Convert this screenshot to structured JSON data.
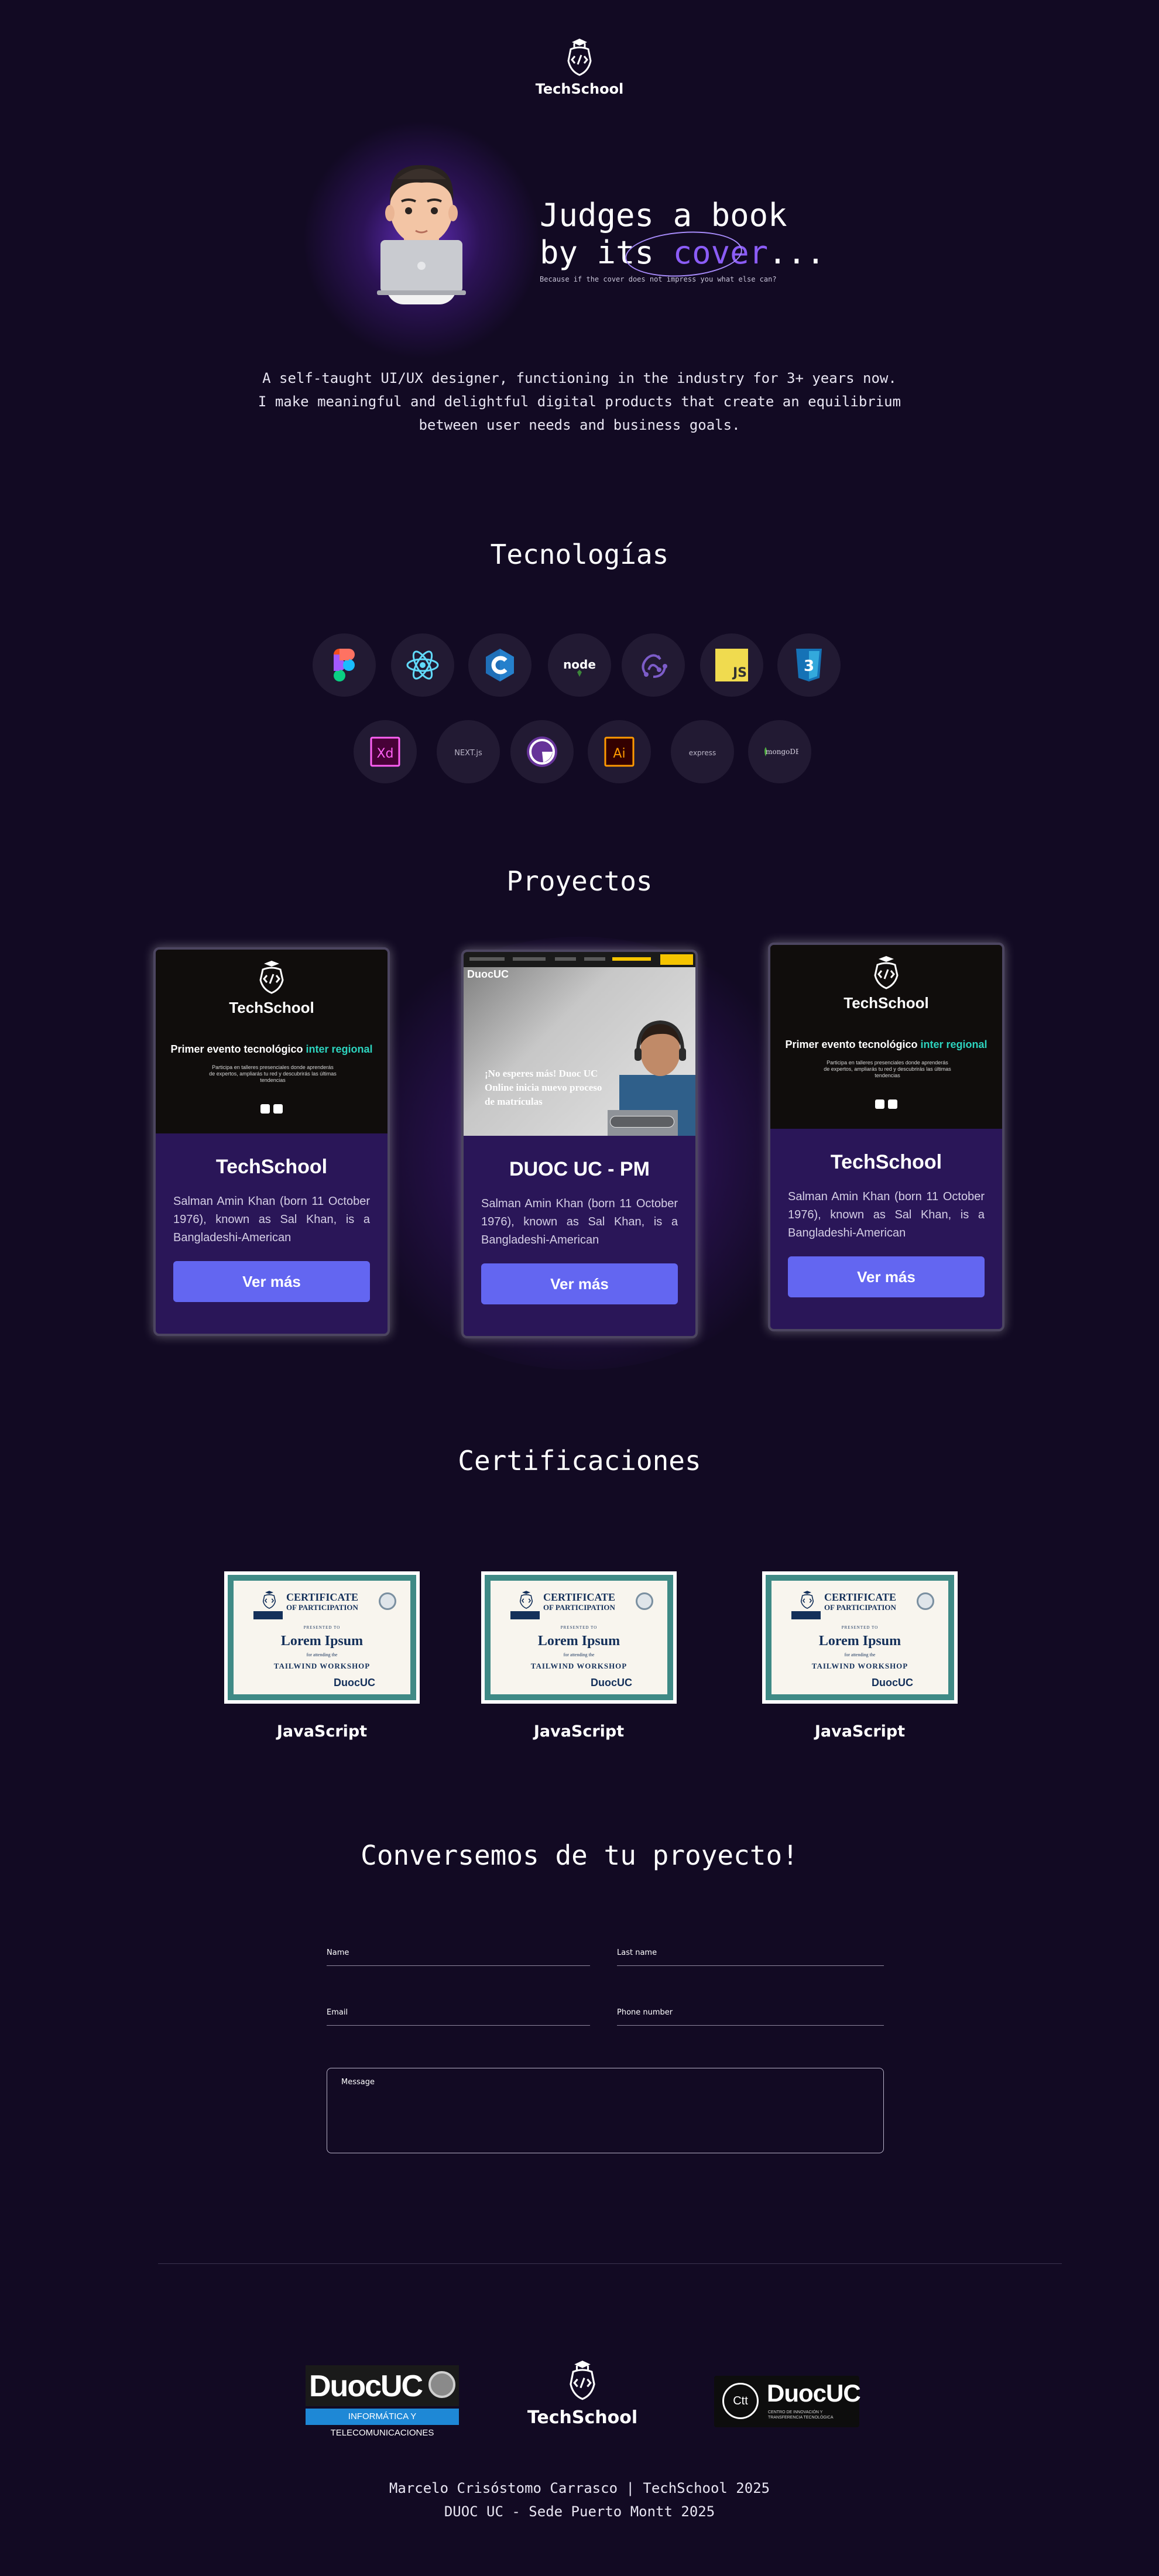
{
  "header": {
    "brand": "TechSchool"
  },
  "hero": {
    "title_line1": "Judges a book",
    "title_line2_prefix": "by its ",
    "title_highlight": "cover",
    "title_suffix": "...",
    "subtitle": "Because if the cover does not impress you what else can?"
  },
  "intro": {
    "line1": "A self-taught UI/UX designer, functioning in the industry for 3+ years now.",
    "line2": "I make meaningful and delightful digital products that create an equilibrium",
    "line3": "between user needs and business goals."
  },
  "tech": {
    "title": "Tecnologías",
    "icons": [
      "figma-icon",
      "react-icon",
      "c-icon",
      "nodejs-icon",
      "redux-icon",
      "javascript-icon",
      "css3-icon",
      "adobe-xd-icon",
      "nextjs-icon",
      "gatsby-icon",
      "illustrator-icon",
      "express-icon",
      "mongodb-icon"
    ],
    "labels": {
      "node": "node",
      "js": "JS",
      "css": "3",
      "xd": "Xd",
      "next": "NEXT.js",
      "ai": "Ai",
      "express": "express",
      "mongo": "mongoDB"
    }
  },
  "projects": {
    "title": "Proyectos",
    "items": [
      {
        "title": "TechSchool",
        "desc": "Salman Amin Khan (born 11 October 1976), known as Sal Khan, is a Bangladeshi-American",
        "button": "Ver más",
        "thumb_brand": "TechSchool",
        "thumb_head_prefix": "Primer evento tecnológico ",
        "thumb_head_accent": "inter regional",
        "thumb_small": "Participa en talleres presenciales donde aprenderás de expertos, ampliarás tu red y descubrirás las últimas tendencias"
      },
      {
        "title": "DUOC UC - PM",
        "desc": "Salman Amin Khan (born 11 October 1976), known as Sal Khan, is a Bangladeshi-American",
        "button": "Ver más",
        "thumb_brand": "DuocUC",
        "thumb_slogan": "¡No esperes más! Duoc UC Online inicia nuevo proceso de matrículas"
      },
      {
        "title": "TechSchool",
        "desc": "Salman Amin Khan (born 11 October 1976), known as Sal Khan, is a Bangladeshi-American",
        "button": "Ver más",
        "thumb_brand": "TechSchool",
        "thumb_head_prefix": "Primer evento tecnológico ",
        "thumb_head_accent": "inter regional",
        "thumb_small": "Participa en talleres presenciales donde aprenderás de expertos, ampliarás tu red y descubrirás las últimas tendencias"
      }
    ]
  },
  "certs": {
    "title": "Certificaciones",
    "items": [
      {
        "label": "JavaScript",
        "t1": "CERTIFICATE",
        "t2": "OF PARTICIPATION",
        "presented": "PRESENTED TO",
        "name": "Lorem Ipsum",
        "for": "for attending the",
        "workshop": "TAILWIND WORKSHOP",
        "issuer": "DuocUC"
      },
      {
        "label": "JavaScript",
        "t1": "CERTIFICATE",
        "t2": "OF PARTICIPATION",
        "presented": "PRESENTED TO",
        "name": "Lorem Ipsum",
        "for": "for attending the",
        "workshop": "TAILWIND WORKSHOP",
        "issuer": "DuocUC"
      },
      {
        "label": "JavaScript",
        "t1": "CERTIFICATE",
        "t2": "OF PARTICIPATION",
        "presented": "PRESENTED TO",
        "name": "Lorem Ipsum",
        "for": "for attending the",
        "workshop": "TAILWIND WORKSHOP",
        "issuer": "DuocUC"
      }
    ]
  },
  "contact": {
    "title": "Conversemos de tu proyecto!",
    "name_label": "Name",
    "lastname_label": "Last name",
    "email_label": "Email",
    "phone_label": "Phone number",
    "message_label": "Message"
  },
  "footer": {
    "logo_left_brand": "DuocUC",
    "logo_left_tag": "INFORMÁTICA Y TELECOMUNICACIONES",
    "logo_center": "TechSchool",
    "logo_right_brand": "DuocUC",
    "logo_right_ctt": "Ctt",
    "logo_right_sub": "CENTRO DE INNOVACIÓN Y TRANSFERENCIA TECNOLÓGICA",
    "line1": "Marcelo Crisóstomo Carrasco | TechSchool 2025",
    "line2": "DUOC UC - Sede Puerto Montt 2025"
  },
  "colors": {
    "background": "#120a23",
    "accent": "#6366f1",
    "highlight": "#8b5cf6",
    "teal": "#2dd4bf"
  }
}
